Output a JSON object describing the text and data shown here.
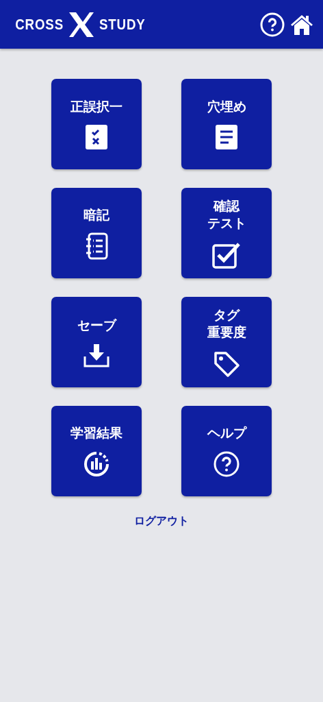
{
  "header": {
    "logo": {
      "left": "CROSS",
      "right": "STUDY"
    },
    "actions": [
      {
        "kind": "help"
      },
      {
        "kind": "home"
      }
    ]
  },
  "menu_rows": [
    {
      "tiles": [
        {
          "lines": [
            "正誤択一"
          ],
          "kind": "quiz"
        },
        {
          "lines": [
            "穴埋め"
          ],
          "kind": "document"
        }
      ]
    },
    {
      "tiles": [
        {
          "lines": [
            "暗記"
          ],
          "kind": "notebook"
        },
        {
          "lines": [
            "確認",
            "テスト"
          ],
          "kind": "checkbox"
        }
      ]
    },
    {
      "tiles": [
        {
          "lines": [
            "セーブ"
          ],
          "kind": "download"
        },
        {
          "lines": [
            "タグ",
            "重要度"
          ],
          "kind": "tag"
        }
      ]
    },
    {
      "tiles": [
        {
          "lines": [
            "学習結果"
          ],
          "kind": "chart"
        },
        {
          "lines": [
            "ヘルプ"
          ],
          "kind": "help"
        }
      ]
    }
  ],
  "logout": "ログアウト"
}
